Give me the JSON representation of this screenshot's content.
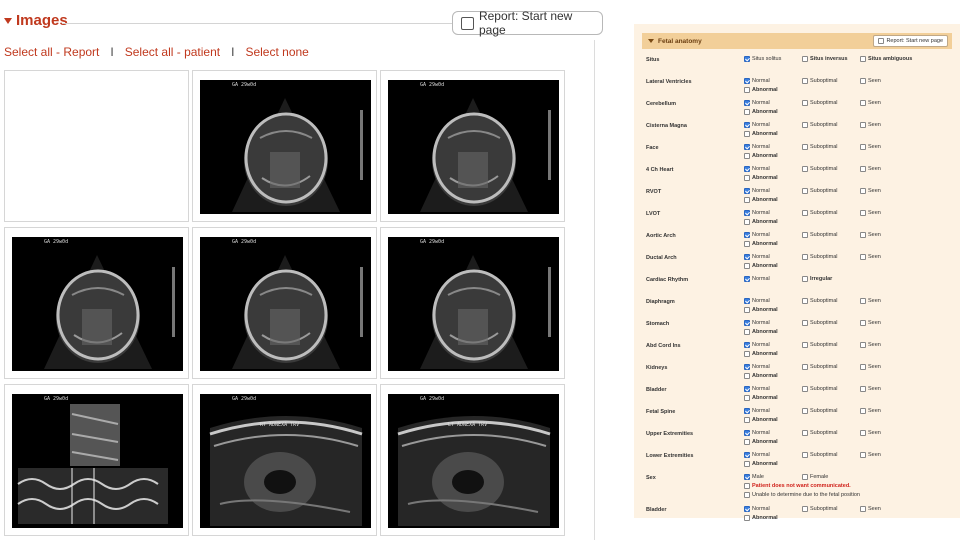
{
  "images": {
    "title": "Images",
    "report_button_label": "Report: Start new page",
    "links": {
      "select_all_report": "Select all - Report",
      "select_all_patient": "Select all - patient",
      "select_none": "Select none",
      "separator": "I"
    },
    "thumbnails": [
      {
        "kind": "empty"
      },
      {
        "kind": "head",
        "label": "GA 29w0d"
      },
      {
        "kind": "head",
        "label": "GA 29w0d"
      },
      {
        "kind": "head",
        "label": "GA 29w0d"
      },
      {
        "kind": "head",
        "label": "GA 29w0d"
      },
      {
        "kind": "head",
        "label": "GA 29w0d"
      },
      {
        "kind": "mmode",
        "label": "GA 29w0d"
      },
      {
        "kind": "adnexa",
        "label": "GA 29w0d",
        "annotation": "RT ADNEXA TRV"
      },
      {
        "kind": "adnexa",
        "label": "GA 29w0d",
        "annotation": "LT ADNEXA TRV"
      }
    ]
  },
  "anatomy": {
    "title": "Fetal anatomy",
    "report_button_label": "Report: Start new page",
    "rows": [
      {
        "name": "Situs",
        "options": [
          {
            "label": "Situs solitus",
            "checked": true,
            "col": 1,
            "line": 1
          },
          {
            "label": "Situs inversus",
            "checked": false,
            "col": 2,
            "line": 1,
            "bold": true
          },
          {
            "label": "Situs ambiguous",
            "checked": false,
            "col": 3,
            "line": 1,
            "bold": true
          }
        ]
      },
      {
        "name": "Lateral Ventricles",
        "options": [
          {
            "label": "Normal",
            "checked": true,
            "col": 1,
            "line": 1
          },
          {
            "label": "Suboptimal",
            "checked": false,
            "col": 2,
            "line": 1
          },
          {
            "label": "Seen",
            "checked": false,
            "col": 3,
            "line": 1
          },
          {
            "label": "Abnormal",
            "checked": false,
            "col": 1,
            "line": 2,
            "bold": true
          }
        ]
      },
      {
        "name": "Cerebellum",
        "options": [
          {
            "label": "Normal",
            "checked": true,
            "col": 1,
            "line": 1
          },
          {
            "label": "Suboptimal",
            "checked": false,
            "col": 2,
            "line": 1
          },
          {
            "label": "Seen",
            "checked": false,
            "col": 3,
            "line": 1
          },
          {
            "label": "Abnormal",
            "checked": false,
            "col": 1,
            "line": 2,
            "bold": true
          }
        ]
      },
      {
        "name": "Cisterna Magna",
        "options": [
          {
            "label": "Normal",
            "checked": true,
            "col": 1,
            "line": 1
          },
          {
            "label": "Suboptimal",
            "checked": false,
            "col": 2,
            "line": 1
          },
          {
            "label": "Seen",
            "checked": false,
            "col": 3,
            "line": 1
          },
          {
            "label": "Abnormal",
            "checked": false,
            "col": 1,
            "line": 2,
            "bold": true
          }
        ]
      },
      {
        "name": "Face",
        "options": [
          {
            "label": "Normal",
            "checked": true,
            "col": 1,
            "line": 1
          },
          {
            "label": "Suboptimal",
            "checked": false,
            "col": 2,
            "line": 1
          },
          {
            "label": "Seen",
            "checked": false,
            "col": 3,
            "line": 1
          },
          {
            "label": "Abnormal",
            "checked": false,
            "col": 1,
            "line": 2,
            "bold": true
          }
        ]
      },
      {
        "name": "4 Ch Heart",
        "options": [
          {
            "label": "Normal",
            "checked": true,
            "col": 1,
            "line": 1
          },
          {
            "label": "Suboptimal",
            "checked": false,
            "col": 2,
            "line": 1
          },
          {
            "label": "Seen",
            "checked": false,
            "col": 3,
            "line": 1
          },
          {
            "label": "Abnormal",
            "checked": false,
            "col": 1,
            "line": 2,
            "bold": true
          }
        ]
      },
      {
        "name": "RVOT",
        "options": [
          {
            "label": "Normal",
            "checked": true,
            "col": 1,
            "line": 1
          },
          {
            "label": "Suboptimal",
            "checked": false,
            "col": 2,
            "line": 1
          },
          {
            "label": "Seen",
            "checked": false,
            "col": 3,
            "line": 1
          },
          {
            "label": "Abnormal",
            "checked": false,
            "col": 1,
            "line": 2,
            "bold": true
          }
        ]
      },
      {
        "name": "LVOT",
        "options": [
          {
            "label": "Normal",
            "checked": true,
            "col": 1,
            "line": 1
          },
          {
            "label": "Suboptimal",
            "checked": false,
            "col": 2,
            "line": 1
          },
          {
            "label": "Seen",
            "checked": false,
            "col": 3,
            "line": 1
          },
          {
            "label": "Abnormal",
            "checked": false,
            "col": 1,
            "line": 2,
            "bold": true
          }
        ]
      },
      {
        "name": "Aortic Arch",
        "options": [
          {
            "label": "Normal",
            "checked": true,
            "col": 1,
            "line": 1
          },
          {
            "label": "Suboptimal",
            "checked": false,
            "col": 2,
            "line": 1
          },
          {
            "label": "Seen",
            "checked": false,
            "col": 3,
            "line": 1
          },
          {
            "label": "Abnormal",
            "checked": false,
            "col": 1,
            "line": 2,
            "bold": true
          }
        ]
      },
      {
        "name": "Ductal Arch",
        "options": [
          {
            "label": "Normal",
            "checked": true,
            "col": 1,
            "line": 1
          },
          {
            "label": "Suboptimal",
            "checked": false,
            "col": 2,
            "line": 1
          },
          {
            "label": "Seen",
            "checked": false,
            "col": 3,
            "line": 1
          },
          {
            "label": "Abnormal",
            "checked": false,
            "col": 1,
            "line": 2,
            "bold": true
          }
        ]
      },
      {
        "name": "Cardiac Rhythm",
        "options": [
          {
            "label": "Normal",
            "checked": true,
            "col": 1,
            "line": 1
          },
          {
            "label": "Irregular",
            "checked": false,
            "col": 2,
            "line": 1,
            "bold": true
          }
        ]
      },
      {
        "name": "Diaphragm",
        "options": [
          {
            "label": "Normal",
            "checked": true,
            "col": 1,
            "line": 1
          },
          {
            "label": "Suboptimal",
            "checked": false,
            "col": 2,
            "line": 1
          },
          {
            "label": "Seen",
            "checked": false,
            "col": 3,
            "line": 1
          },
          {
            "label": "Abnormal",
            "checked": false,
            "col": 1,
            "line": 2,
            "bold": true
          }
        ]
      },
      {
        "name": "Stomach",
        "options": [
          {
            "label": "Normal",
            "checked": true,
            "col": 1,
            "line": 1
          },
          {
            "label": "Suboptimal",
            "checked": false,
            "col": 2,
            "line": 1
          },
          {
            "label": "Seen",
            "checked": false,
            "col": 3,
            "line": 1
          },
          {
            "label": "Abnormal",
            "checked": false,
            "col": 1,
            "line": 2,
            "bold": true
          }
        ]
      },
      {
        "name": "Abd Cord Ins",
        "options": [
          {
            "label": "Normal",
            "checked": true,
            "col": 1,
            "line": 1
          },
          {
            "label": "Suboptimal",
            "checked": false,
            "col": 2,
            "line": 1
          },
          {
            "label": "Seen",
            "checked": false,
            "col": 3,
            "line": 1
          },
          {
            "label": "Abnormal",
            "checked": false,
            "col": 1,
            "line": 2,
            "bold": true
          }
        ]
      },
      {
        "name": "Kidneys",
        "options": [
          {
            "label": "Normal",
            "checked": true,
            "col": 1,
            "line": 1
          },
          {
            "label": "Suboptimal",
            "checked": false,
            "col": 2,
            "line": 1
          },
          {
            "label": "Seen",
            "checked": false,
            "col": 3,
            "line": 1
          },
          {
            "label": "Abnormal",
            "checked": false,
            "col": 1,
            "line": 2,
            "bold": true
          }
        ]
      },
      {
        "name": "Bladder",
        "options": [
          {
            "label": "Normal",
            "checked": true,
            "col": 1,
            "line": 1
          },
          {
            "label": "Suboptimal",
            "checked": false,
            "col": 2,
            "line": 1
          },
          {
            "label": "Seen",
            "checked": false,
            "col": 3,
            "line": 1
          },
          {
            "label": "Abnormal",
            "checked": false,
            "col": 1,
            "line": 2,
            "bold": true
          }
        ]
      },
      {
        "name": "Fetal Spine",
        "options": [
          {
            "label": "Normal",
            "checked": true,
            "col": 1,
            "line": 1
          },
          {
            "label": "Suboptimal",
            "checked": false,
            "col": 2,
            "line": 1
          },
          {
            "label": "Seen",
            "checked": false,
            "col": 3,
            "line": 1
          },
          {
            "label": "Abnormal",
            "checked": false,
            "col": 1,
            "line": 2,
            "bold": true
          }
        ]
      },
      {
        "name": "Upper Extremities",
        "options": [
          {
            "label": "Normal",
            "checked": true,
            "col": 1,
            "line": 1
          },
          {
            "label": "Suboptimal",
            "checked": false,
            "col": 2,
            "line": 1
          },
          {
            "label": "Seen",
            "checked": false,
            "col": 3,
            "line": 1
          },
          {
            "label": "Abnormal",
            "checked": false,
            "col": 1,
            "line": 2,
            "bold": true
          }
        ]
      },
      {
        "name": "Lower Extremities",
        "options": [
          {
            "label": "Normal",
            "checked": true,
            "col": 1,
            "line": 1
          },
          {
            "label": "Suboptimal",
            "checked": false,
            "col": 2,
            "line": 1
          },
          {
            "label": "Seen",
            "checked": false,
            "col": 3,
            "line": 1
          },
          {
            "label": "Abnormal",
            "checked": false,
            "col": 1,
            "line": 2,
            "bold": true
          }
        ]
      },
      {
        "name": "Sex",
        "tall": true,
        "options": [
          {
            "label": "Male",
            "checked": true,
            "col": 1,
            "line": 1
          },
          {
            "label": "Female",
            "checked": false,
            "col": 2,
            "line": 1
          },
          {
            "label": "Patient does not want communicated.",
            "checked": false,
            "col": 1,
            "line": 2,
            "red": true
          },
          {
            "label": "Unable to determine due to the fetal position",
            "checked": false,
            "col": 1,
            "line": 3
          }
        ]
      },
      {
        "name": "Bladder",
        "options": [
          {
            "label": "Normal",
            "checked": true,
            "col": 1,
            "line": 1
          },
          {
            "label": "Suboptimal",
            "checked": false,
            "col": 2,
            "line": 1
          },
          {
            "label": "Seen",
            "checked": false,
            "col": 3,
            "line": 1
          },
          {
            "label": "Abnormal",
            "checked": false,
            "col": 1,
            "line": 2,
            "bold": true
          }
        ]
      }
    ]
  }
}
